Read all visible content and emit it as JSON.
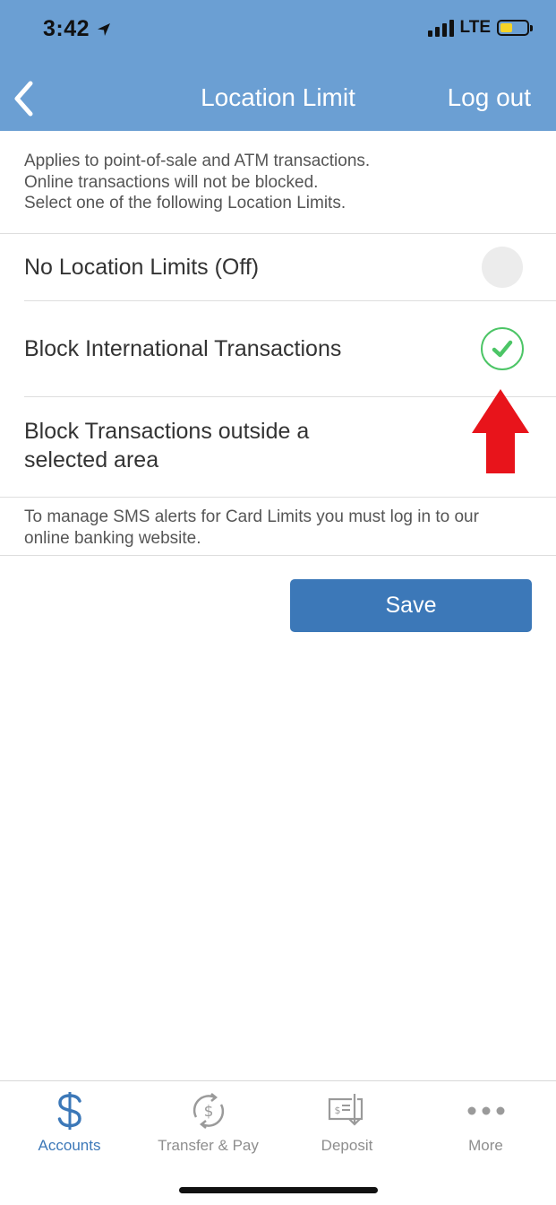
{
  "status": {
    "time": "3:42",
    "network": "LTE"
  },
  "nav": {
    "title": "Location Limit",
    "logout_label": "Log out"
  },
  "intro": {
    "line1": "Applies to point-of-sale and ATM transactions.",
    "line2": "Online transactions will not be blocked.",
    "line3": "Select one of the following Location Limits."
  },
  "options": [
    {
      "label": "No Location Limits (Off)",
      "selected": false
    },
    {
      "label": "Block International Transactions",
      "selected": true
    },
    {
      "label_line1": "Block Transactions outside a",
      "label_line2": "selected area",
      "selected": false
    }
  ],
  "footnote": {
    "line1": "To manage SMS alerts for Card Limits you must log in to our",
    "line2": "online banking website."
  },
  "save_label": "Save",
  "tabs": [
    {
      "label": "Accounts",
      "icon": "dollar-icon",
      "active": true
    },
    {
      "label": "Transfer & Pay",
      "icon": "transfer-icon",
      "active": false
    },
    {
      "label": "Deposit",
      "icon": "check-deposit-icon",
      "active": false
    },
    {
      "label": "More",
      "icon": "more-dots-icon",
      "active": false
    }
  ],
  "colors": {
    "header": "#6b9fd3",
    "accent": "#3c78b8",
    "check_green": "#4cc566",
    "annotation_red": "#e8141b"
  }
}
